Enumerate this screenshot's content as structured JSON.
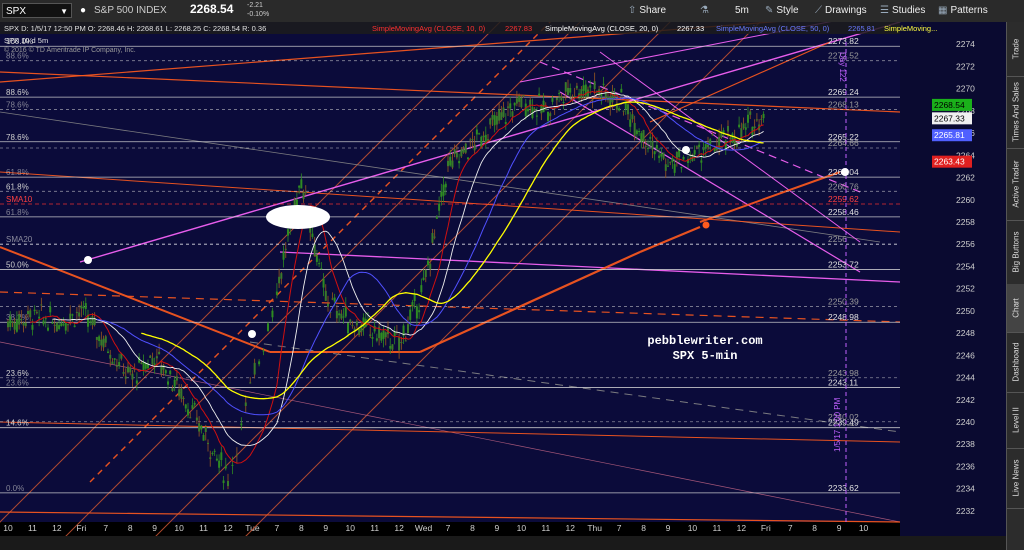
{
  "header": {
    "symbol": "SPX",
    "index_name": "S&P 500 INDEX",
    "last_price": "2268.54",
    "change": "-2.21",
    "change_pct": "-0.10%",
    "buttons": {
      "share": "Share",
      "period": "5m",
      "style": "Style",
      "drawings": "Drawings",
      "studies": "Studies",
      "patterns": "Patterns"
    }
  },
  "legend": {
    "quote": "SPX  D: 1/5/17 12:50 PM  O: 2268.46  H: 2268.61  L: 2268.25  C: 2268.54  R: 0.36",
    "sma10": "SimpleMovingAvg (CLOSE, 10, 0)",
    "sma10_val": "2267.83",
    "sma20": "SimpleMovingAvg (CLOSE, 20, 0)",
    "sma20_val": "2267.33",
    "sma50": "SimpleMovingAvg (CLOSE, 50, 0)",
    "sma50_val": "2265.81",
    "sma_extra": "SimpleMoving...",
    "symbol_period": "SPX 10 d 5m",
    "copyright": "© 2016 © TD Ameritrade IP Company, Inc."
  },
  "annotations": {
    "site": "pebblewriter.com",
    "subtitle": "SPX 5-min",
    "vline1": "Day 122",
    "vline2": "1/5/17 1:00 PM",
    "fib_labels": [
      "100.0%",
      "88.6%",
      "88.6%",
      "78.6%",
      "78.6%",
      "61.8%",
      "61.8%",
      "61.8%",
      "50.0%",
      "38.2%",
      "23.6%",
      "23.6%",
      "14.6%",
      "0.0%",
      "SMA10",
      "SMA20"
    ],
    "levels": [
      "2273.82",
      "2272.52",
      "2269.24",
      "2268.13",
      "2265.22",
      "2264.66",
      "2262.04",
      "2260.76",
      "2259.62",
      "2258.46",
      "2256",
      "2253.72",
      "2250.39",
      "2248.98",
      "2243.98",
      "2243.11",
      "2240.02",
      "2239.49",
      "2233.62"
    ]
  },
  "right_tabs": [
    "Trade",
    "Times And Sales",
    "Active Trader",
    "Big Buttons",
    "Chart",
    "Dashboard",
    "Level II",
    "Live News"
  ],
  "colors": {
    "bg": "#0b0b3a",
    "candle": "#2e8b22",
    "sma10": "#d01010",
    "sma20": "#f0f0f0",
    "sma50": "#5050ff",
    "sma_yellow": "#ffff00",
    "fib": "#e0e0e0",
    "orange": "#ff5a1e",
    "magenta": "#ff66ff"
  },
  "chart_data": {
    "type": "candlestick",
    "title": "SPX 10 d 5m",
    "ylim": [
      2231,
      2276
    ],
    "y_ticks": [
      2232,
      2234,
      2236,
      2238,
      2240,
      2242,
      2244,
      2246,
      2248,
      2250,
      2252,
      2254,
      2256,
      2258,
      2260,
      2262,
      2264,
      2266,
      2268,
      2270,
      2272,
      2274
    ],
    "x_tick_labels": [
      "10",
      "11",
      "12",
      "Fri",
      "7",
      "8",
      "9",
      "10",
      "11",
      "12",
      "Tue",
      "7",
      "8",
      "9",
      "10",
      "11",
      "12",
      "Wed",
      "7",
      "8",
      "9",
      "10",
      "11",
      "12",
      "Thu",
      "7",
      "8",
      "9",
      "10",
      "11",
      "12",
      "Fri",
      "7",
      "8",
      "9",
      "10"
    ],
    "price_path": [
      [
        "Thu 10",
        2249
      ],
      [
        "Thu 11",
        2249.5
      ],
      [
        "Thu 12",
        2249
      ],
      [
        "Fri",
        2250
      ],
      [
        "Fri 7",
        2247
      ],
      [
        "Fri 8",
        2244
      ],
      [
        "Fri 9",
        2246
      ],
      [
        "Fri 10",
        2243
      ],
      [
        "Fri 11",
        2239
      ],
      [
        "Fri 12",
        2235
      ],
      [
        "Tue",
        2252
      ],
      [
        "Tue 7",
        2262
      ],
      [
        "Tue 8",
        2251
      ],
      [
        "Tue 9",
        2249
      ],
      [
        "Tue 10",
        2248
      ],
      [
        "Tue 11",
        2247
      ],
      [
        "Tue 12",
        2252
      ],
      [
        "Wed",
        2263
      ],
      [
        "Wed 7",
        2265
      ],
      [
        "Wed 8",
        2267
      ],
      [
        "Wed 9",
        2269
      ],
      [
        "Wed 10",
        2268
      ],
      [
        "Wed 11",
        2270
      ],
      [
        "Wed 12",
        2270
      ],
      [
        "Thu",
        2269
      ],
      [
        "Thu 7",
        2266
      ],
      [
        "Thu 8",
        2263
      ],
      [
        "Thu 9",
        2264
      ],
      [
        "Thu 10",
        2265
      ],
      [
        "Thu 11",
        2266
      ],
      [
        "Thu 12",
        2268
      ]
    ],
    "current_values": {
      "last": 2268.54,
      "sma20": 2267.33,
      "sma50": 2265.81,
      "sma_red": 2263.43
    }
  }
}
